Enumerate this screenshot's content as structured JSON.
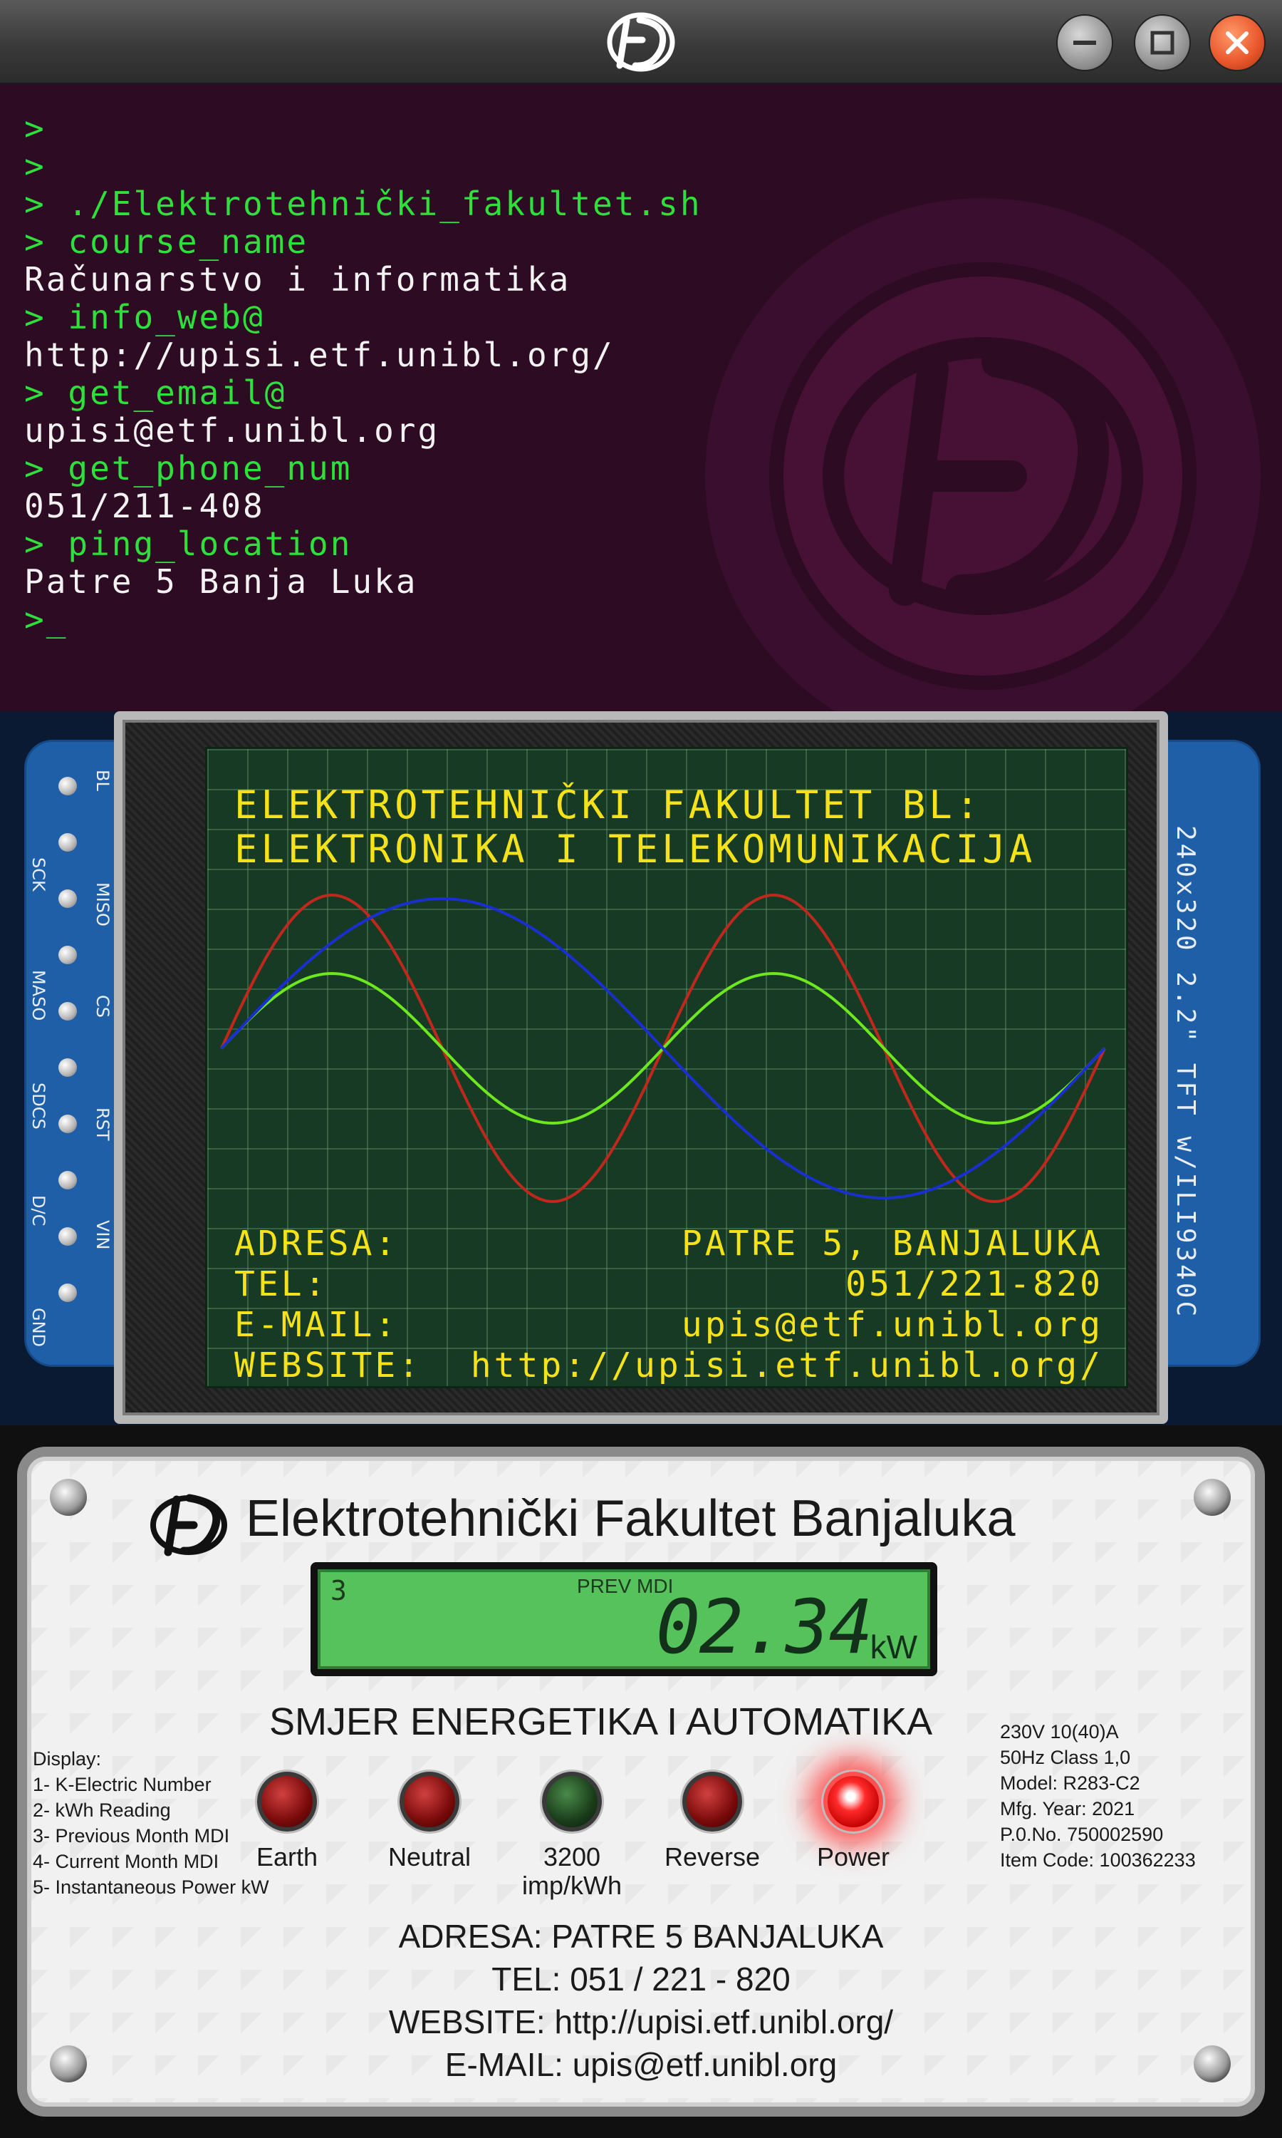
{
  "terminal": {
    "lines": [
      {
        "text": ">",
        "kind": "cmd"
      },
      {
        "text": ">",
        "kind": "cmd"
      },
      {
        "text": "> ./Elektrotehnički_fakultet.sh",
        "kind": "cmd"
      },
      {
        "text": "> course_name",
        "kind": "cmd"
      },
      {
        "text": "Računarstvo i informatika",
        "kind": "out"
      },
      {
        "text": "> info_web@",
        "kind": "cmd"
      },
      {
        "text": "http://upisi.etf.unibl.org/",
        "kind": "out"
      },
      {
        "text": "> get_email@",
        "kind": "cmd"
      },
      {
        "text": "upisi@etf.unibl.org",
        "kind": "out"
      },
      {
        "text": "> get_phone_num",
        "kind": "cmd"
      },
      {
        "text": "051/211-408",
        "kind": "out"
      },
      {
        "text": "> ping_location",
        "kind": "cmd"
      },
      {
        "text": "Patre 5 Banja Luka",
        "kind": "out"
      }
    ],
    "prompt": ">_",
    "colors": {
      "background": "#2d0b22",
      "command": "#2fe03c",
      "output": "#f2f2f2"
    }
  },
  "titlebar": {
    "buttons": [
      "minimize-icon",
      "maximize-icon",
      "close-icon"
    ],
    "logo": "etf-logo"
  },
  "tft": {
    "title_line1": "ELEKTROTEHNIČKI FAKULTET BL:",
    "title_line2": "ELEKTRONIKA I TELEKOMUNIKACIJA",
    "pins": [
      "BL",
      "SCK",
      "MISO",
      "MASO",
      "CS",
      "SDCS",
      "RST",
      "D/C",
      "VIN",
      "GND"
    ],
    "side_label": "240x320  2.2\"  TFT  w/ILI9340C",
    "rows": [
      {
        "label": "ADRESA:",
        "value": "PATRE 5, BANJALUKA"
      },
      {
        "label": "TEL:",
        "value": "051/221-820"
      },
      {
        "label": "E-MAIL:",
        "value": "upis@etf.unibl.org"
      },
      {
        "label": "WEBSITE:",
        "value": "http://upisi.etf.unibl.org/"
      }
    ],
    "text_color": "#f5e21a",
    "wave_colors": {
      "red": "#c0281e",
      "blue": "#1a2fd0",
      "green": "#6ee81e"
    }
  },
  "meter": {
    "title": "Elektrotehnički Fakultet Banjaluka",
    "lcd": {
      "mode": "3",
      "label": "PREV MDI",
      "value": "02.34",
      "unit": "kW"
    },
    "subtitle": "SMJER ENERGETIKA I AUTOMATIKA",
    "display_list": [
      "Display:",
      "1- K-Electric Number",
      "2- kWh Reading",
      "3- Previous Month MDI",
      "4- Current Month MDI",
      "5- Instantaneous Power kW"
    ],
    "specs": [
      "230V 10(40)A",
      "50Hz Class 1,0",
      "Model: R283-C2",
      "Mfg. Year: 2021",
      "P.0.No. 750002590",
      "Item Code: 100362233"
    ],
    "leds": [
      {
        "label": "Earth",
        "label2": "",
        "state": "red"
      },
      {
        "label": "Neutral",
        "label2": "",
        "state": "red"
      },
      {
        "label": "3200",
        "label2": "imp/kWh",
        "state": "green"
      },
      {
        "label": "Reverse",
        "label2": "",
        "state": "red"
      },
      {
        "label": "Power",
        "label2": "",
        "state": "on"
      }
    ],
    "address_lines": [
      "ADRESA: PATRE 5 BANJALUKA",
      "TEL: 051 / 221 - 820",
      "WEBSITE: http://upisi.etf.unibl.org/",
      "E-MAIL: upis@etf.unibl.org"
    ]
  }
}
